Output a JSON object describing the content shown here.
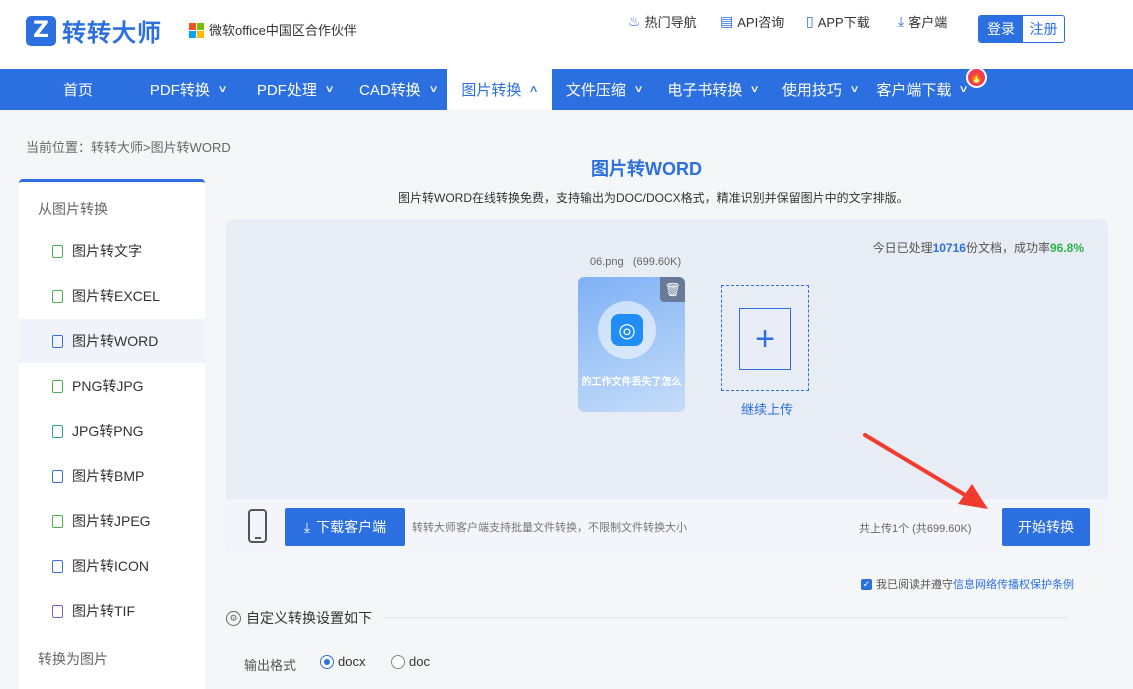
{
  "header": {
    "logo_mark": "Z",
    "logo_text": "转转大师",
    "partner": "微软office中国区合作伙伴",
    "links": [
      {
        "label": "热门导航",
        "icon": "flame-icon"
      },
      {
        "label": "API咨询",
        "icon": "chat-icon"
      },
      {
        "label": "APP下载",
        "icon": "phone-icon"
      },
      {
        "label": "客户端",
        "icon": "download-icon"
      }
    ],
    "login": "登录",
    "register": "注册"
  },
  "nav": {
    "items": [
      {
        "label": "首页",
        "chevron": ""
      },
      {
        "label": "PDF转换",
        "chevron": "∨"
      },
      {
        "label": "PDF处理",
        "chevron": "∨"
      },
      {
        "label": "CAD转换",
        "chevron": "∨"
      },
      {
        "label": "图片转换",
        "chevron": "∧"
      },
      {
        "label": "文件压缩",
        "chevron": "∨"
      },
      {
        "label": "电子书转换",
        "chevron": "∨"
      },
      {
        "label": "使用技巧",
        "chevron": "∨"
      },
      {
        "label": "客户端下载",
        "chevron": "∨"
      }
    ],
    "hot_badge": "🔥"
  },
  "breadcrumb": "当前位置：转转大师>图片转WORD",
  "sidebar": {
    "group1": "从图片转换",
    "items": [
      {
        "label": "图片转文字"
      },
      {
        "label": "图片转EXCEL"
      },
      {
        "label": "图片转WORD"
      },
      {
        "label": "PNG转JPG"
      },
      {
        "label": "JPG转PNG"
      },
      {
        "label": "图片转BMP"
      },
      {
        "label": "图片转JPEG"
      },
      {
        "label": "图片转ICON"
      },
      {
        "label": "图片转TIF"
      }
    ],
    "group2": "转换为图片"
  },
  "main": {
    "title": "图片转WORD",
    "subtitle": "图片转WORD在线转换免费，支持输出为DOC/DOCX格式，精准识别并保留图片中的文字排版。",
    "stats_prefix": "今日已处理",
    "stats_count": "10716",
    "stats_mid": "份文档，成功率",
    "stats_rate": "96.8%",
    "file": {
      "name": "06.png",
      "size": "(699.60K)",
      "thumb_text": "的工作文件丢失了怎么"
    },
    "add_more": "继续上传",
    "download_client": "下载客户端",
    "client_note": "转转大师客户端支持批量文件转换，不限制文件转换大小",
    "upload_count": "共上传1个 (共699.60K)",
    "start": "开始转换",
    "agree_prefix": "我已阅读并遵守",
    "agree_link": "信息网络传播权保护条例",
    "settings_title": "自定义转换设置如下",
    "format_label": "输出格式",
    "formats": [
      "docx",
      "doc"
    ],
    "selected_format": "docx"
  }
}
